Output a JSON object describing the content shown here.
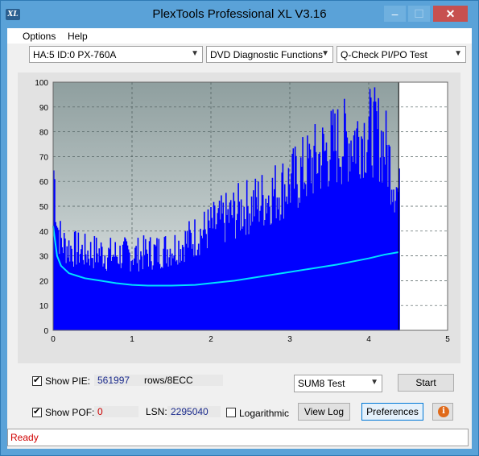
{
  "window": {
    "title": "PlexTools Professional XL V3.16",
    "icon_text": "XL"
  },
  "menu": [
    {
      "label": "Options",
      "key": "O"
    },
    {
      "label": "Help",
      "key": "H"
    }
  ],
  "toolbar": {
    "drive": "HA:5 ID:0  PX-760A",
    "function": "DVD Diagnostic Functions",
    "test": "Q-Check PI/PO Test"
  },
  "controls": {
    "show_pie_label": "Show PIE:",
    "pie_value": "561997",
    "pie_unit": "rows/8ECC",
    "show_poe_label": "Show POF:",
    "poe_value": "0",
    "lsn_label": "LSN:",
    "lsn_value": "2295040",
    "logarithmic_label": "Logarithmic",
    "mode_select": "SUM8 Test",
    "start_label": "Start",
    "view_log_label": "View Log",
    "preferences_label": "Preferences",
    "info_icon": "info-icon"
  },
  "status": {
    "text": "Ready",
    "color": "#d00000"
  },
  "chart_data": {
    "type": "area",
    "xlim": [
      0,
      5
    ],
    "ylim": [
      0,
      100
    ],
    "x_ticks": [
      "0",
      "1",
      "2",
      "3",
      "4",
      "5"
    ],
    "y_ticks": [
      "0",
      "10",
      "20",
      "30",
      "40",
      "50",
      "60",
      "70",
      "80",
      "90",
      "100"
    ],
    "grid": true,
    "data_end_x": 4.38,
    "series": [
      {
        "kind": "bars",
        "color": "#0000ff",
        "x": [
          0.0,
          0.05,
          0.1,
          0.2,
          0.3,
          0.4,
          0.5,
          0.6,
          0.7,
          0.8,
          0.9,
          1.0,
          1.1,
          1.2,
          1.3,
          1.4,
          1.5,
          1.6,
          1.7,
          1.8,
          1.9,
          2.0,
          2.1,
          2.2,
          2.3,
          2.4,
          2.5,
          2.6,
          2.7,
          2.8,
          2.9,
          3.0,
          3.1,
          3.2,
          3.3,
          3.4,
          3.5,
          3.6,
          3.7,
          3.8,
          3.9,
          4.0,
          4.1,
          4.2,
          4.3,
          4.38
        ],
        "values": [
          70,
          45,
          38,
          36,
          35,
          34,
          34,
          34,
          33,
          33,
          33,
          33,
          33,
          34,
          34,
          35,
          36,
          37,
          39,
          41,
          43,
          45,
          47,
          49,
          51,
          53,
          54,
          56,
          58,
          60,
          62,
          64,
          67,
          70,
          73,
          76,
          79,
          81,
          82,
          84,
          85,
          86,
          85,
          80,
          68,
          58
        ]
      },
      {
        "kind": "line",
        "color": "#00e0ff",
        "x": [
          0.0,
          0.05,
          0.1,
          0.2,
          0.3,
          0.4,
          0.5,
          0.6,
          0.8,
          1.0,
          1.2,
          1.5,
          1.8,
          2.0,
          2.3,
          2.6,
          3.0,
          3.3,
          3.6,
          4.0,
          4.2,
          4.38
        ],
        "values": [
          42,
          30,
          26,
          23,
          22,
          21,
          20.5,
          20,
          19,
          18.3,
          18,
          18,
          18.3,
          19,
          20,
          21.5,
          23.5,
          25,
          26.5,
          29,
          30.5,
          31.5
        ]
      }
    ]
  }
}
